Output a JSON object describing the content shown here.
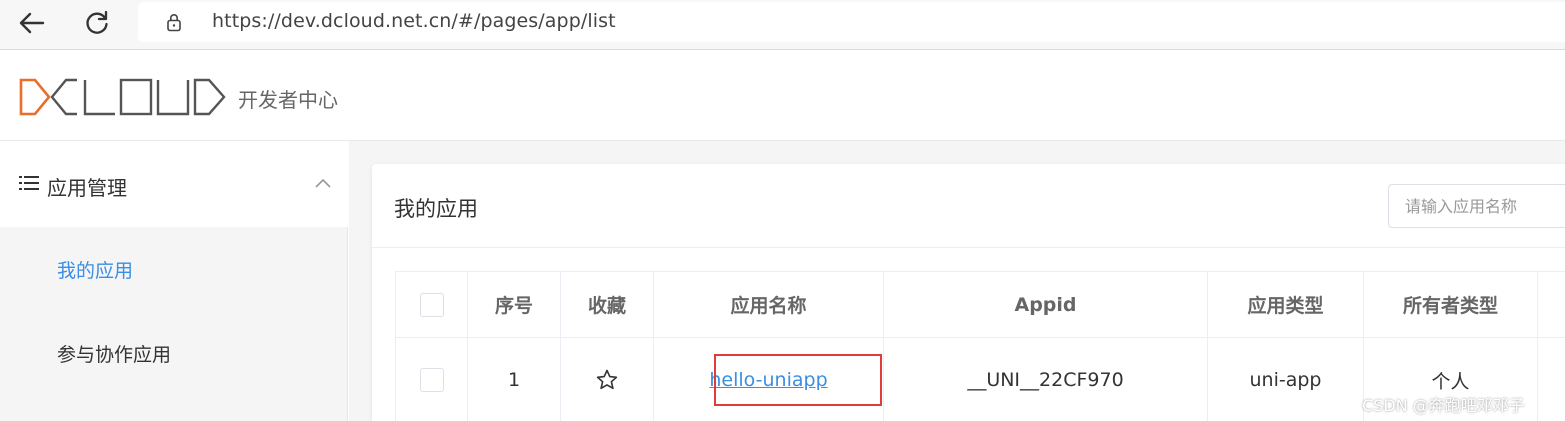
{
  "browser": {
    "url": "https://dev.dcloud.net.cn/#/pages/app/list",
    "back_icon": "arrow-left-icon",
    "reload_icon": "reload-icon",
    "lock_icon": "lock-icon"
  },
  "header": {
    "logo_text": "DCLOUD",
    "logo_caption": "开发者中心",
    "brand_accent": "#e86f2b"
  },
  "sidebar": {
    "group": {
      "icon": "list-icon",
      "label": "应用管理",
      "expanded_icon": "chevron-up-icon"
    },
    "items": [
      {
        "label": "我的应用",
        "active": true
      },
      {
        "label": "参与协作应用",
        "active": false
      }
    ],
    "active_color": "#3a8ee6"
  },
  "main": {
    "title": "我的应用",
    "search": {
      "placeholder": "请输入应用名称",
      "value": ""
    },
    "table": {
      "columns": [
        "",
        "序号",
        "收藏",
        "应用名称",
        "Appid",
        "应用类型",
        "所有者类型"
      ],
      "rows": [
        {
          "checked": false,
          "index": "1",
          "favorite_icon": "star-outline-icon",
          "name": "hello-uniapp",
          "appid": "__UNI__22CF970",
          "app_type": "uni-app",
          "owner_type": "个人"
        }
      ]
    },
    "highlight_color": "#e03c3c"
  },
  "watermark": "CSDN @奔跑吧邓邓子"
}
